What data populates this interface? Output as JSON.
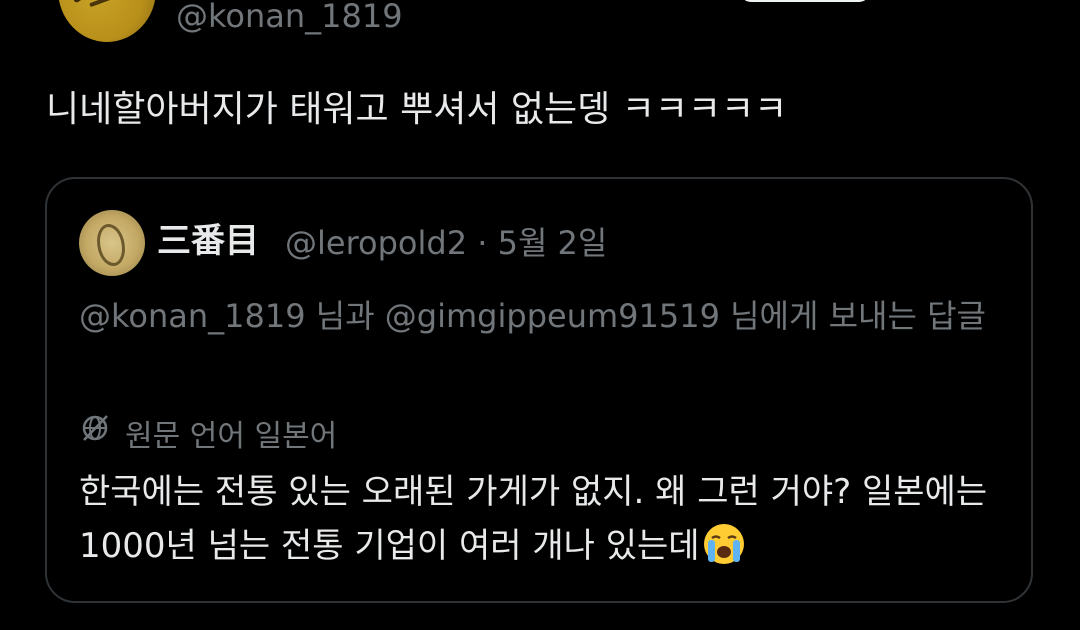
{
  "author": {
    "handle": "@konan_1819"
  },
  "tweet": {
    "text": "니네할아버지가 태워고 뿌셔서 없는뎅 ㅋㅋㅋㅋㅋ"
  },
  "quote": {
    "display_name": "三番目",
    "handle": "@leropold2",
    "separator": "·",
    "date": "5월 2일",
    "reply_to": "@konan_1819 님과 @gimgippeum91519 님에게 보내는 답글",
    "translate_note": "원문 언어 일본어",
    "text": "한국에는 전통 있는 오래된 가게가 없지. 왜 그런 거야? 일본에는 1000년 넘는 전통 기업이 여러 개나 있는데",
    "emoji": "loudly-crying-face-icon"
  },
  "colors": {
    "background": "#000000",
    "text_primary": "#e7e9ea",
    "text_secondary": "#71767b",
    "border": "#2f3336"
  }
}
